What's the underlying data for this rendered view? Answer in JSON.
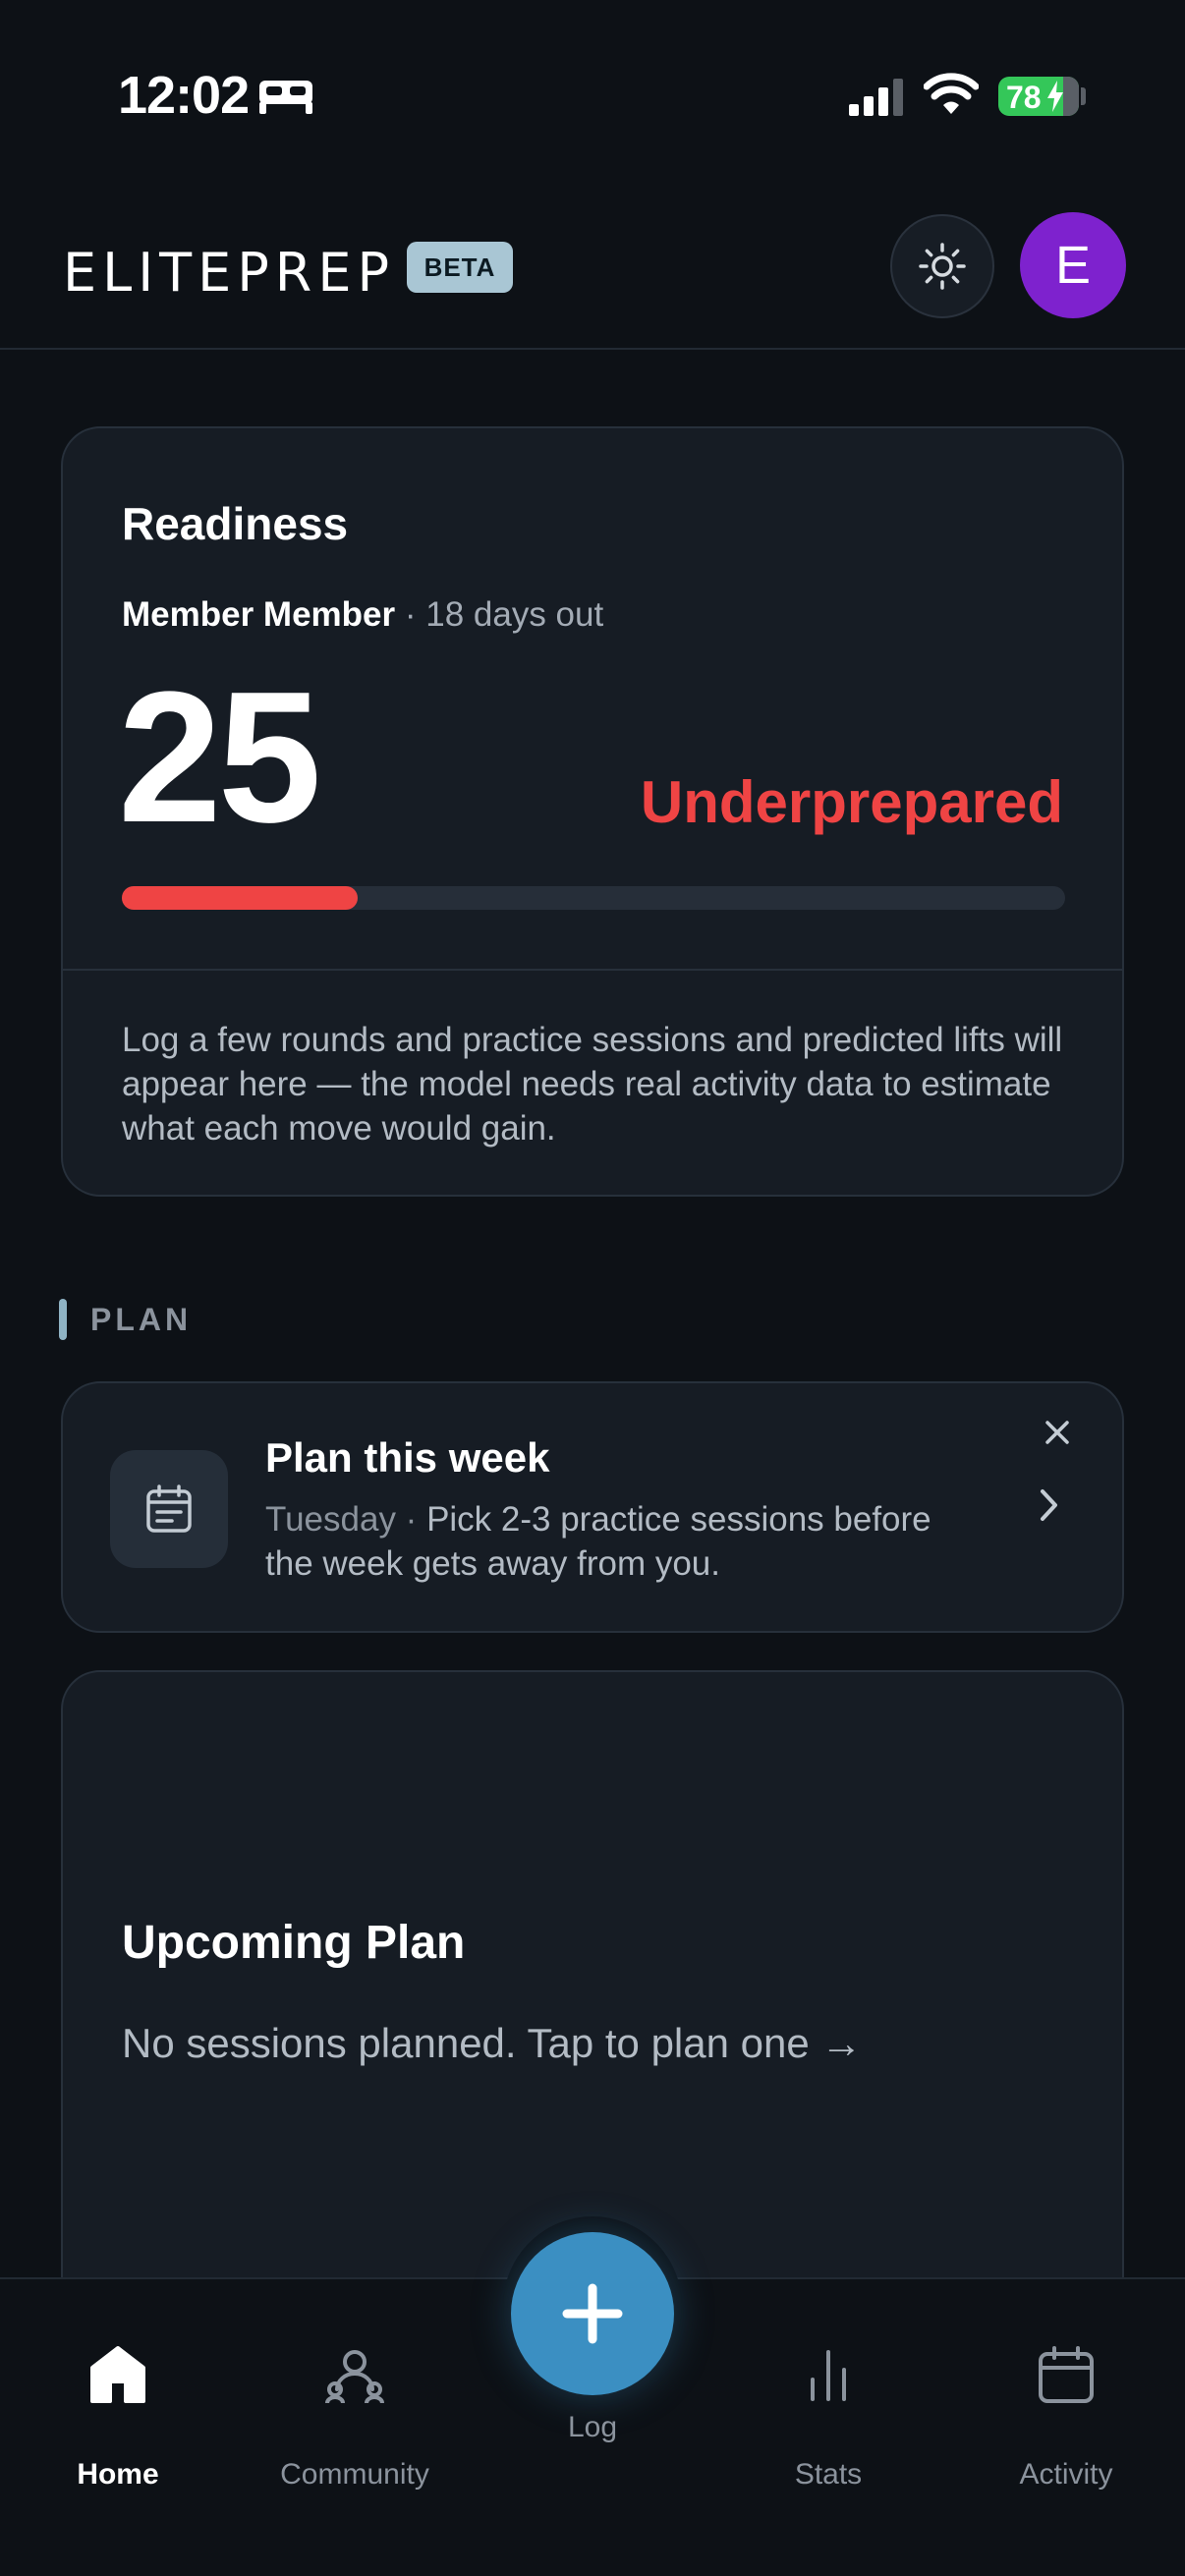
{
  "status_bar": {
    "time": "12:02",
    "battery": "78",
    "icons": [
      "bed-icon",
      "signal-icon",
      "wifi-icon",
      "battery-icon"
    ]
  },
  "header": {
    "brand": "ELITEPREP",
    "badge": "BETA",
    "avatar_letter": "E",
    "theme_icon": "sun-icon",
    "colors": {
      "avatar": "#7e22ce",
      "badge": "#a9c6d4"
    }
  },
  "readiness": {
    "title": "Readiness",
    "member_name": "Member Member",
    "separator": " · ",
    "days_out": "18 days out",
    "score": "25",
    "status": "Underprepared",
    "progress_percent": 25,
    "note": "Log a few rounds and practice sessions and predicted lifts will appear here — the model needs real activity data to estimate what each move would gain.",
    "colors": {
      "status": "#ef4444",
      "track": "#262e39"
    }
  },
  "plan_section": {
    "label": "PLAN"
  },
  "plan_week": {
    "title": "Plan this week",
    "day": "Tuesday",
    "separator": " · ",
    "description": "Pick 2-3 practice sessions before the week gets away from you.",
    "icon": "calendar-list-icon"
  },
  "upcoming_plan": {
    "title": "Upcoming Plan",
    "empty_text": "No sessions planned. Tap to plan one →"
  },
  "bottom_nav": {
    "items": [
      {
        "label": "Home",
        "icon": "home-icon",
        "active": true
      },
      {
        "label": "Community",
        "icon": "community-icon",
        "active": false
      },
      {
        "label": "Log",
        "icon": "plus-icon",
        "active": false
      },
      {
        "label": "Stats",
        "icon": "stats-icon",
        "active": false
      },
      {
        "label": "Activity",
        "icon": "calendar-icon",
        "active": false
      }
    ],
    "colors": {
      "fab": "#3b8fc2"
    }
  }
}
